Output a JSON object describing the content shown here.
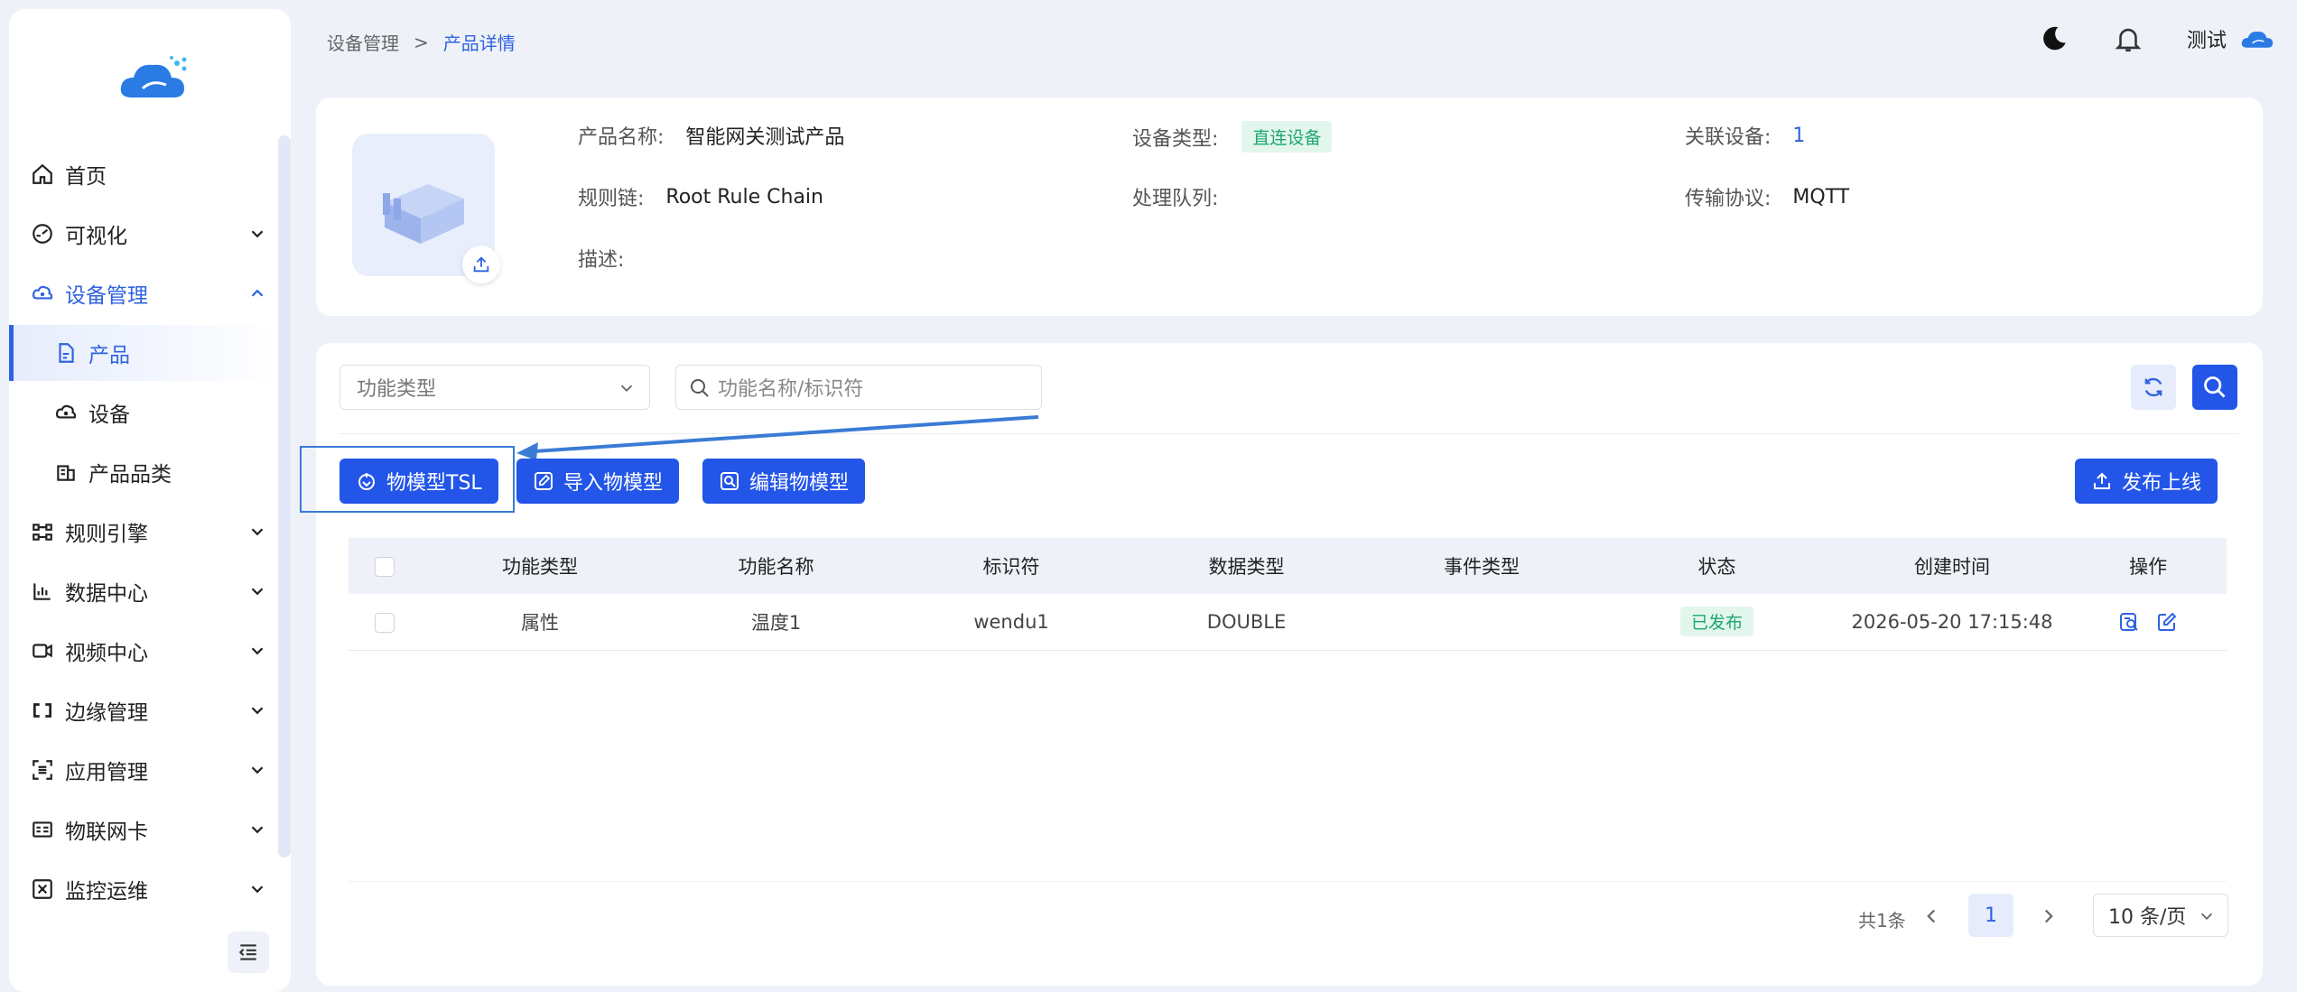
{
  "sidebar": {
    "items": [
      {
        "label": "首页",
        "icon": "home-icon"
      },
      {
        "label": "可视化",
        "icon": "dashboard-icon"
      },
      {
        "label": "设备管理",
        "icon": "device-cloud-icon"
      },
      {
        "label": "产品",
        "icon": "document-icon"
      },
      {
        "label": "设备",
        "icon": "device-icon"
      },
      {
        "label": "产品品类",
        "icon": "category-icon"
      },
      {
        "label": "规则引擎",
        "icon": "rule-icon"
      },
      {
        "label": "数据中心",
        "icon": "chart-icon"
      },
      {
        "label": "视频中心",
        "icon": "video-icon"
      },
      {
        "label": "边缘管理",
        "icon": "edge-icon"
      },
      {
        "label": "应用管理",
        "icon": "app-icon"
      },
      {
        "label": "物联网卡",
        "icon": "sim-card-icon"
      },
      {
        "label": "监控运维",
        "icon": "monitor-icon"
      }
    ]
  },
  "header": {
    "breadcrumb": [
      "设备管理",
      "产品详情"
    ],
    "user_name": "测试"
  },
  "product": {
    "name_label": "产品名称:",
    "name_value": "智能网关测试产品",
    "device_type_label": "设备类型:",
    "device_type_value": "直连设备",
    "linked_label": "关联设备:",
    "linked_value": "1",
    "rule_chain_label": "规则链:",
    "rule_chain_value": "Root Rule Chain",
    "queue_label": "处理队列:",
    "queue_value": "",
    "protocol_label": "传输协议:",
    "protocol_value": "MQTT",
    "desc_label": "描述:",
    "desc_value": ""
  },
  "filters": {
    "type_placeholder": "功能类型",
    "search_placeholder": "功能名称/标识符"
  },
  "actions": {
    "tsl": "物模型TSL",
    "import": "导入物模型",
    "edit": "编辑物模型",
    "publish": "发布上线"
  },
  "table": {
    "columns": [
      "",
      "功能类型",
      "功能名称",
      "标识符",
      "数据类型",
      "事件类型",
      "状态",
      "创建时间",
      "操作"
    ],
    "rows": [
      {
        "type": "属性",
        "name": "温度1",
        "identifier": "wendu1",
        "data_type": "DOUBLE",
        "event_type": "",
        "status": "已发布",
        "created": "2026-05-20 17:15:48"
      }
    ]
  },
  "pagination": {
    "total": "共1条",
    "current": "1",
    "page_size": "10 条/页"
  },
  "colors": {
    "primary": "#2356e8",
    "accent": "#2f63e0",
    "success": "#1ea672",
    "background": "#eef1f8"
  }
}
